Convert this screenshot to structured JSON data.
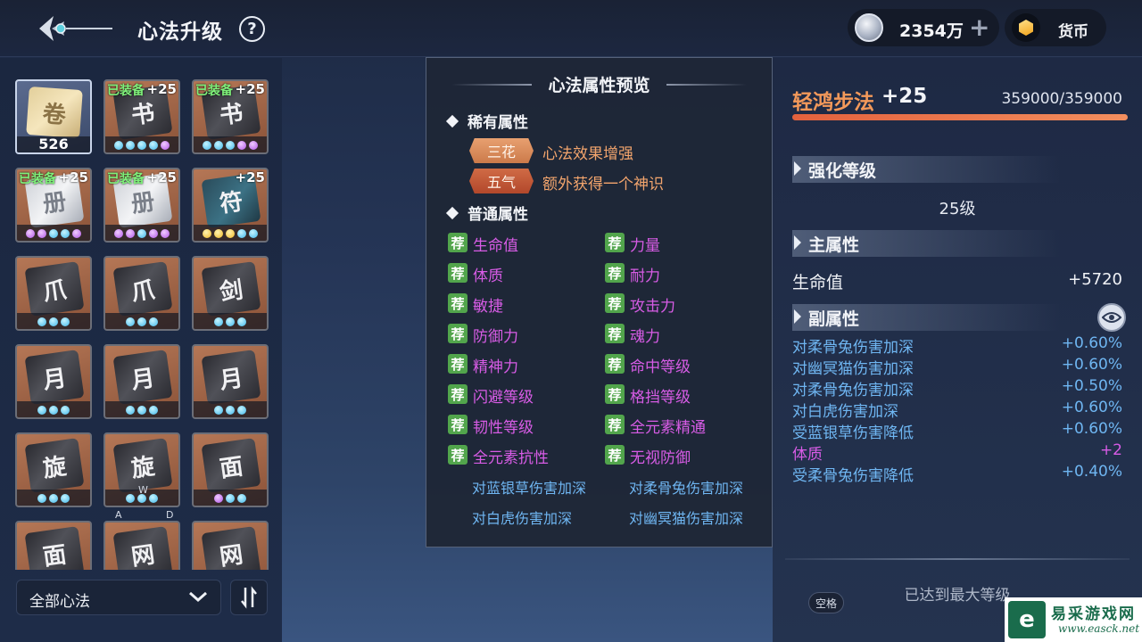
{
  "header": {
    "title": "心法升级",
    "help_symbol": "?",
    "coins": "2354万",
    "coin_add": "+",
    "currency_label": "货币",
    "back_icon": "ornate-back-arrow-icon"
  },
  "inventory": {
    "items": [
      {
        "type": "paper",
        "count": "526",
        "equipped": "",
        "level": "",
        "dots": []
      },
      {
        "type": "dark",
        "count": "",
        "equipped": "已装备",
        "level": "+25",
        "dots": [
          "b",
          "b",
          "b",
          "b",
          "p"
        ]
      },
      {
        "type": "dark",
        "count": "",
        "equipped": "已装备",
        "level": "+25",
        "dots": [
          "b",
          "b",
          "b",
          "p",
          "p"
        ]
      },
      {
        "type": "silver",
        "count": "",
        "equipped": "已装备",
        "level": "+25",
        "dots": [
          "p",
          "p",
          "b",
          "b",
          "p"
        ]
      },
      {
        "type": "silver",
        "count": "",
        "equipped": "已装备",
        "level": "+25",
        "dots": [
          "p",
          "p",
          "b",
          "p",
          "p"
        ]
      },
      {
        "type": "teal",
        "count": "",
        "equipped": "",
        "level": "+25",
        "dots": [
          "y",
          "y",
          "y",
          "b",
          "b"
        ]
      },
      {
        "type": "dark",
        "count": "",
        "equipped": "",
        "level": "",
        "dots": [
          "b",
          "b",
          "b"
        ]
      },
      {
        "type": "dark",
        "count": "",
        "equipped": "",
        "level": "",
        "dots": [
          "b",
          "b",
          "b"
        ]
      },
      {
        "type": "dark",
        "count": "",
        "equipped": "",
        "level": "",
        "dots": [
          "b",
          "b",
          "b"
        ]
      },
      {
        "type": "dark",
        "count": "",
        "equipped": "",
        "level": "",
        "dots": [
          "b",
          "b",
          "b"
        ]
      },
      {
        "type": "dark",
        "count": "",
        "equipped": "",
        "level": "",
        "dots": [
          "b",
          "b",
          "b"
        ]
      },
      {
        "type": "dark",
        "count": "",
        "equipped": "",
        "level": "",
        "dots": [
          "b",
          "b",
          "b"
        ]
      },
      {
        "type": "dark",
        "count": "",
        "equipped": "",
        "level": "",
        "dots": [
          "b",
          "b",
          "b"
        ]
      },
      {
        "type": "dark",
        "count": "",
        "equipped": "",
        "level": "",
        "dots": [
          "b",
          "b",
          "b"
        ]
      },
      {
        "type": "dark",
        "count": "",
        "equipped": "",
        "level": "",
        "dots": [
          "p",
          "b",
          "b"
        ]
      },
      {
        "type": "dark",
        "count": "",
        "equipped": "",
        "level": "",
        "dots": []
      },
      {
        "type": "dark",
        "count": "",
        "equipped": "",
        "level": "",
        "dots": []
      },
      {
        "type": "dark",
        "count": "",
        "equipped": "",
        "level": "",
        "dots": []
      }
    ],
    "filter_label": "全部心法",
    "sort_icon": "sort-arrows-icon",
    "key_hints": {
      "w": "W",
      "a": "A",
      "d": "D"
    }
  },
  "preview": {
    "title": "心法属性预览",
    "rare_heading": "稀有属性",
    "rare": [
      {
        "badge": "三花",
        "text": "心法效果增强"
      },
      {
        "badge": "五气",
        "text": "额外获得一个神识"
      }
    ],
    "normal_heading": "普通属性",
    "tag": "荐",
    "normal_attrs": [
      [
        "生命值",
        "力量"
      ],
      [
        "体质",
        "耐力"
      ],
      [
        "敏捷",
        "攻击力"
      ],
      [
        "防御力",
        "魂力"
      ],
      [
        "精神力",
        "命中等级"
      ],
      [
        "闪避等级",
        "格挡等级"
      ],
      [
        "韧性等级",
        "全元素精通"
      ],
      [
        "全元素抗性",
        "无视防御"
      ]
    ],
    "extra_attrs": [
      [
        "对蓝银草伤害加深",
        "对柔骨兔伤害加深"
      ],
      [
        "对白虎伤害加深",
        "对幽冥猫伤害加深"
      ]
    ]
  },
  "detail": {
    "skill_name": "轻鸿步法",
    "skill_level": "+25",
    "exp_text": "359000/359000",
    "exp_progress": 1.0,
    "enhance_heading": "强化等级",
    "enhance_value": "25级",
    "main_heading": "主属性",
    "main_attr_name": "生命值",
    "main_attr_value": "+5720",
    "sub_heading": "副属性",
    "eye_icon": "eye-icon",
    "sub_attrs": [
      {
        "name": "对柔骨兔伤害加深",
        "value": "+0.60%",
        "color": "blue"
      },
      {
        "name": "对幽冥猫伤害加深",
        "value": "+0.60%",
        "color": "blue"
      },
      {
        "name": "对柔骨兔伤害加深",
        "value": "+0.50%",
        "color": "blue"
      },
      {
        "name": "对白虎伤害加深",
        "value": "+0.60%",
        "color": "blue"
      },
      {
        "name": "受蓝银草伤害降低",
        "value": "+0.60%",
        "color": "blue"
      },
      {
        "name": "体质",
        "value": "+2",
        "color": "pink"
      },
      {
        "name": "受柔骨兔伤害降低",
        "value": "+0.40%",
        "color": "blue"
      }
    ],
    "maxed_text": "已达到最大等级",
    "space_key": "空格"
  },
  "watermark": {
    "logo_char": "e",
    "cn": "易采游戏网",
    "en": "www.easck.net"
  },
  "colors": {
    "accent_orange": "#f3995a",
    "attr_purple": "#d85ce6",
    "attr_blue": "#6fb6f2",
    "tag_green": "#52a54c"
  }
}
